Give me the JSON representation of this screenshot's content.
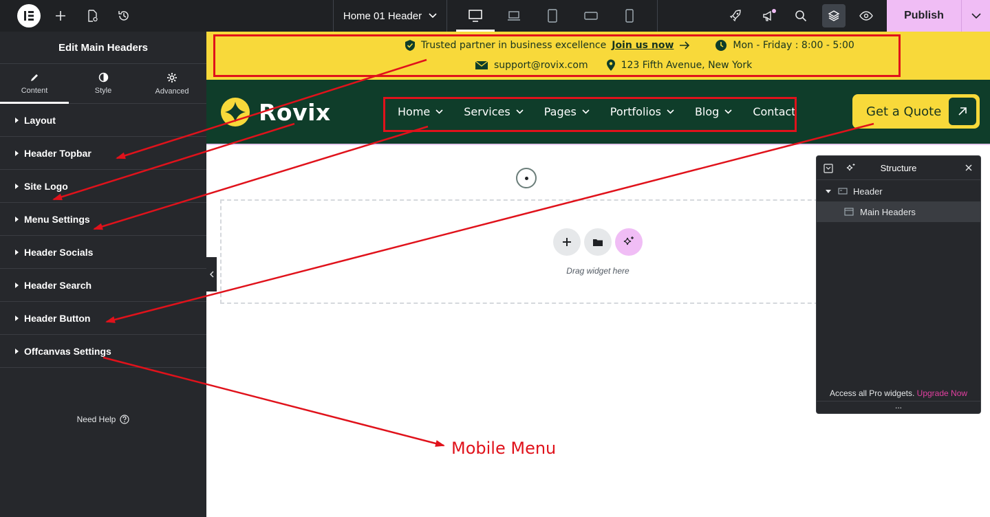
{
  "editor": {
    "document_title": "Home 01 Header",
    "publish_label": "Publish",
    "devices": [
      "desktop-icon",
      "laptop-icon",
      "tablet-icon",
      "tablet-landscape-icon",
      "mobile-icon"
    ]
  },
  "panel": {
    "title": "Edit Main Headers",
    "tabs": [
      {
        "label": "Content",
        "icon": "pencil-icon"
      },
      {
        "label": "Style",
        "icon": "half-circle-icon"
      },
      {
        "label": "Advanced",
        "icon": "gear-icon"
      }
    ],
    "sections": [
      {
        "label": "Layout"
      },
      {
        "label": "Header Topbar"
      },
      {
        "label": "Site Logo"
      },
      {
        "label": "Menu Settings"
      },
      {
        "label": "Header Socials"
      },
      {
        "label": "Header Search"
      },
      {
        "label": "Header Button"
      },
      {
        "label": "Offcanvas Settings"
      }
    ],
    "help_label": "Need Help"
  },
  "site": {
    "topbar": {
      "trusted_text": "Trusted partner in business excellence",
      "join_link": "Join us now",
      "hours": "Mon - Friday : 8:00 - 5:00",
      "email": "support@rovix.com",
      "address": "123 Fifth Avenue, New York"
    },
    "logo_text": "Rovix",
    "menu": [
      {
        "label": "Home",
        "dropdown": true
      },
      {
        "label": "Services",
        "dropdown": true
      },
      {
        "label": "Pages",
        "dropdown": true
      },
      {
        "label": "Portfolios",
        "dropdown": true
      },
      {
        "label": "Blog",
        "dropdown": true
      },
      {
        "label": "Contact",
        "dropdown": false
      }
    ],
    "cta_label": "Get a Quote",
    "colors": {
      "yellow": "#f8d93a",
      "green": "#0f3d2a"
    }
  },
  "canvas": {
    "drag_text": "Drag widget here"
  },
  "structure": {
    "title": "Structure",
    "items": [
      {
        "label": "Header"
      },
      {
        "label": "Main Headers"
      }
    ],
    "promo_text": "Access all Pro widgets.",
    "upgrade_link": "Upgrade Now",
    "more": "..."
  },
  "annotation": {
    "mobile_menu": "Mobile Menu",
    "color": "#e0121b"
  }
}
